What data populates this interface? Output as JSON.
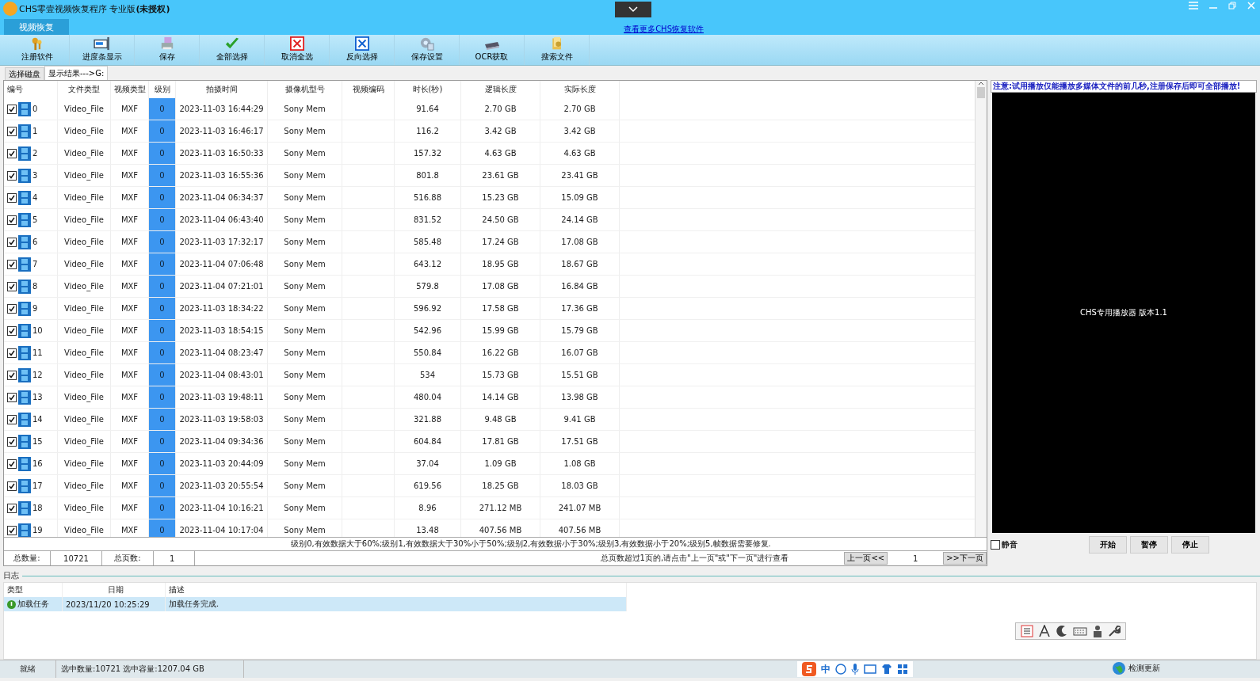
{
  "window": {
    "title": "CHS零壹视频恢复程序 专业版",
    "title_suffix": "(未授权)"
  },
  "menu_tab": {
    "label": "视频恢复",
    "selected": true
  },
  "more_link": "查看更多CHS恢复软件",
  "toolbar": [
    {
      "label": "注册软件"
    },
    {
      "label": "进度条显示"
    },
    {
      "label": "保存"
    },
    {
      "label": "全部选择"
    },
    {
      "label": "取消全选"
    },
    {
      "label": "反向选择"
    },
    {
      "label": "保存设置"
    },
    {
      "label": "OCR获取"
    },
    {
      "label": "搜索文件"
    }
  ],
  "view_tabs": [
    {
      "label": "选择磁盘",
      "selected": false
    },
    {
      "label": "显示结果--->G:",
      "selected": true
    }
  ],
  "table": {
    "columns": [
      "编号",
      "文件类型",
      "视频类型",
      "级别",
      "拍摄时间",
      "摄像机型号",
      "视频编码",
      "时长(秒)",
      "逻辑长度",
      "实际长度"
    ],
    "rows": [
      {
        "checked": true,
        "id": "0",
        "file_type": "Video_File",
        "video_type": "MXF",
        "level": "0",
        "time": "2023-11-03 16:44:29",
        "camera": "Sony Mem",
        "duration": "91.64",
        "logical": "2.70 GB",
        "actual": "2.70 GB"
      },
      {
        "checked": true,
        "id": "1",
        "file_type": "Video_File",
        "video_type": "MXF",
        "level": "0",
        "time": "2023-11-03 16:46:17",
        "camera": "Sony Mem",
        "duration": "116.2",
        "logical": "3.42 GB",
        "actual": "3.42 GB"
      },
      {
        "checked": true,
        "id": "2",
        "file_type": "Video_File",
        "video_type": "MXF",
        "level": "0",
        "time": "2023-11-03 16:50:33",
        "camera": "Sony Mem",
        "duration": "157.32",
        "logical": "4.63 GB",
        "actual": "4.63 GB"
      },
      {
        "checked": true,
        "id": "3",
        "file_type": "Video_File",
        "video_type": "MXF",
        "level": "0",
        "time": "2023-11-03 16:55:36",
        "camera": "Sony Mem",
        "duration": "801.8",
        "logical": "23.61 GB",
        "actual": "23.41 GB"
      },
      {
        "checked": true,
        "id": "4",
        "file_type": "Video_File",
        "video_type": "MXF",
        "level": "0",
        "time": "2023-11-04 06:34:37",
        "camera": "Sony Mem",
        "duration": "516.88",
        "logical": "15.23 GB",
        "actual": "15.09 GB"
      },
      {
        "checked": true,
        "id": "5",
        "file_type": "Video_File",
        "video_type": "MXF",
        "level": "0",
        "time": "2023-11-04 06:43:40",
        "camera": "Sony Mem",
        "duration": "831.52",
        "logical": "24.50 GB",
        "actual": "24.14 GB"
      },
      {
        "checked": true,
        "id": "6",
        "file_type": "Video_File",
        "video_type": "MXF",
        "level": "0",
        "time": "2023-11-03 17:32:17",
        "camera": "Sony Mem",
        "duration": "585.48",
        "logical": "17.24 GB",
        "actual": "17.08 GB"
      },
      {
        "checked": true,
        "id": "7",
        "file_type": "Video_File",
        "video_type": "MXF",
        "level": "0",
        "time": "2023-11-04 07:06:48",
        "camera": "Sony Mem",
        "duration": "643.12",
        "logical": "18.95 GB",
        "actual": "18.67 GB"
      },
      {
        "checked": true,
        "id": "8",
        "file_type": "Video_File",
        "video_type": "MXF",
        "level": "0",
        "time": "2023-11-04 07:21:01",
        "camera": "Sony Mem",
        "duration": "579.8",
        "logical": "17.08 GB",
        "actual": "16.84 GB"
      },
      {
        "checked": true,
        "id": "9",
        "file_type": "Video_File",
        "video_type": "MXF",
        "level": "0",
        "time": "2023-11-03 18:34:22",
        "camera": "Sony Mem",
        "duration": "596.92",
        "logical": "17.58 GB",
        "actual": "17.36 GB"
      },
      {
        "checked": true,
        "id": "10",
        "file_type": "Video_File",
        "video_type": "MXF",
        "level": "0",
        "time": "2023-11-03 18:54:15",
        "camera": "Sony Mem",
        "duration": "542.96",
        "logical": "15.99 GB",
        "actual": "15.79 GB"
      },
      {
        "checked": true,
        "id": "11",
        "file_type": "Video_File",
        "video_type": "MXF",
        "level": "0",
        "time": "2023-11-04 08:23:47",
        "camera": "Sony Mem",
        "duration": "550.84",
        "logical": "16.22 GB",
        "actual": "16.07 GB"
      },
      {
        "checked": true,
        "id": "12",
        "file_type": "Video_File",
        "video_type": "MXF",
        "level": "0",
        "time": "2023-11-04 08:43:01",
        "camera": "Sony Mem",
        "duration": "534",
        "logical": "15.73 GB",
        "actual": "15.51 GB"
      },
      {
        "checked": true,
        "id": "13",
        "file_type": "Video_File",
        "video_type": "MXF",
        "level": "0",
        "time": "2023-11-03 19:48:11",
        "camera": "Sony Mem",
        "duration": "480.04",
        "logical": "14.14 GB",
        "actual": "13.98 GB"
      },
      {
        "checked": true,
        "id": "14",
        "file_type": "Video_File",
        "video_type": "MXF",
        "level": "0",
        "time": "2023-11-03 19:58:03",
        "camera": "Sony Mem",
        "duration": "321.88",
        "logical": "9.48 GB",
        "actual": "9.41 GB"
      },
      {
        "checked": true,
        "id": "15",
        "file_type": "Video_File",
        "video_type": "MXF",
        "level": "0",
        "time": "2023-11-04 09:34:36",
        "camera": "Sony Mem",
        "duration": "604.84",
        "logical": "17.81 GB",
        "actual": "17.51 GB"
      },
      {
        "checked": true,
        "id": "16",
        "file_type": "Video_File",
        "video_type": "MXF",
        "level": "0",
        "time": "2023-11-03 20:44:09",
        "camera": "Sony Mem",
        "duration": "37.04",
        "logical": "1.09 GB",
        "actual": "1.08 GB"
      },
      {
        "checked": true,
        "id": "17",
        "file_type": "Video_File",
        "video_type": "MXF",
        "level": "0",
        "time": "2023-11-03 20:55:54",
        "camera": "Sony Mem",
        "duration": "619.56",
        "logical": "18.25 GB",
        "actual": "18.03 GB"
      },
      {
        "checked": true,
        "id": "18",
        "file_type": "Video_File",
        "video_type": "MXF",
        "level": "0",
        "time": "2023-11-04 10:16:21",
        "camera": "Sony Mem",
        "duration": "8.96",
        "logical": "271.12 MB",
        "actual": "241.07 MB"
      },
      {
        "checked": true,
        "id": "19",
        "file_type": "Video_File",
        "video_type": "MXF",
        "level": "0",
        "time": "2023-11-04 10:17:04",
        "camera": "Sony Mem",
        "duration": "13.48",
        "logical": "407.56 MB",
        "actual": "407.56 MB"
      }
    ]
  },
  "legend": "级别0,有效数据大于60%;级别1,有效数据大于30%小于50%;级别2,有效数据小于30%;级别3,有效数据小于20%;级别5,帧数据需要修复.",
  "pager": {
    "total_label": "总数量:",
    "total": "10721",
    "pages_label": "总页数:",
    "pages": "1",
    "hint": "总页数超过1页的,请点击\"上一页\"或\"下一页\"进行查看",
    "prev": "上一页<<",
    "page": "1",
    "next": ">>下一页"
  },
  "player": {
    "notice": "注意:试用播放仅能播放多媒体文件的前几秒,注册保存后即可全部播放!",
    "screen_text": "CHS专用播放器 版本1.1",
    "mute_label": "静音",
    "muted": false,
    "buttons": [
      "开始",
      "暂停",
      "停止"
    ]
  },
  "log": {
    "title": "日志",
    "columns": [
      "类型",
      "日期",
      "描述"
    ],
    "rows": [
      {
        "type": "加载任务",
        "date": "2023/11/20 10:25:29",
        "desc": "加载任务完成.",
        "selected": true
      }
    ]
  },
  "status_bar": {
    "state": "就绪",
    "selection": "选中数量:10721 选中容量:1207.04 GB",
    "update": "检测更新"
  },
  "ime": {
    "mode": "中"
  }
}
